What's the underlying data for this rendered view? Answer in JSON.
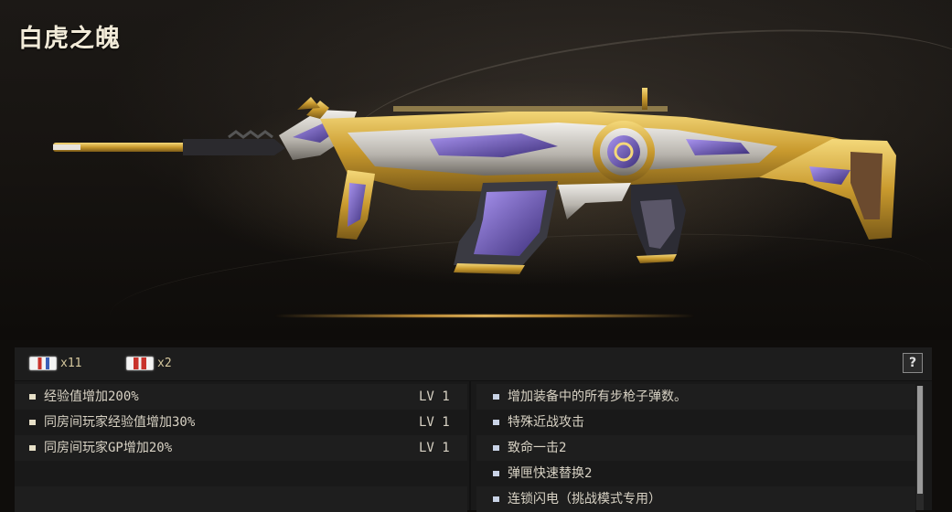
{
  "weapon": {
    "name": "白虎之魄"
  },
  "currency": [
    {
      "icon": "blue-badge-icon",
      "count": "x11"
    },
    {
      "icon": "red-badge-icon",
      "count": "x2"
    }
  ],
  "help_label": "?",
  "attributes": [
    {
      "text": "经验值增加200%",
      "level": "LV 1"
    },
    {
      "text": "同房间玩家经验值增加30%",
      "level": "LV 1"
    },
    {
      "text": "同房间玩家GP增加20%",
      "level": "LV 1"
    }
  ],
  "features": [
    "增加装备中的所有步枪子弹数。",
    "特殊近战攻击",
    "致命一击2",
    "弹匣快速替换2",
    "连锁闪电（挑战模式专用）"
  ],
  "colors": {
    "gold": "#d4b04a",
    "silver": "#c9c6c0",
    "purple": "#7a62c8",
    "accent_glow": "#f3c263"
  }
}
